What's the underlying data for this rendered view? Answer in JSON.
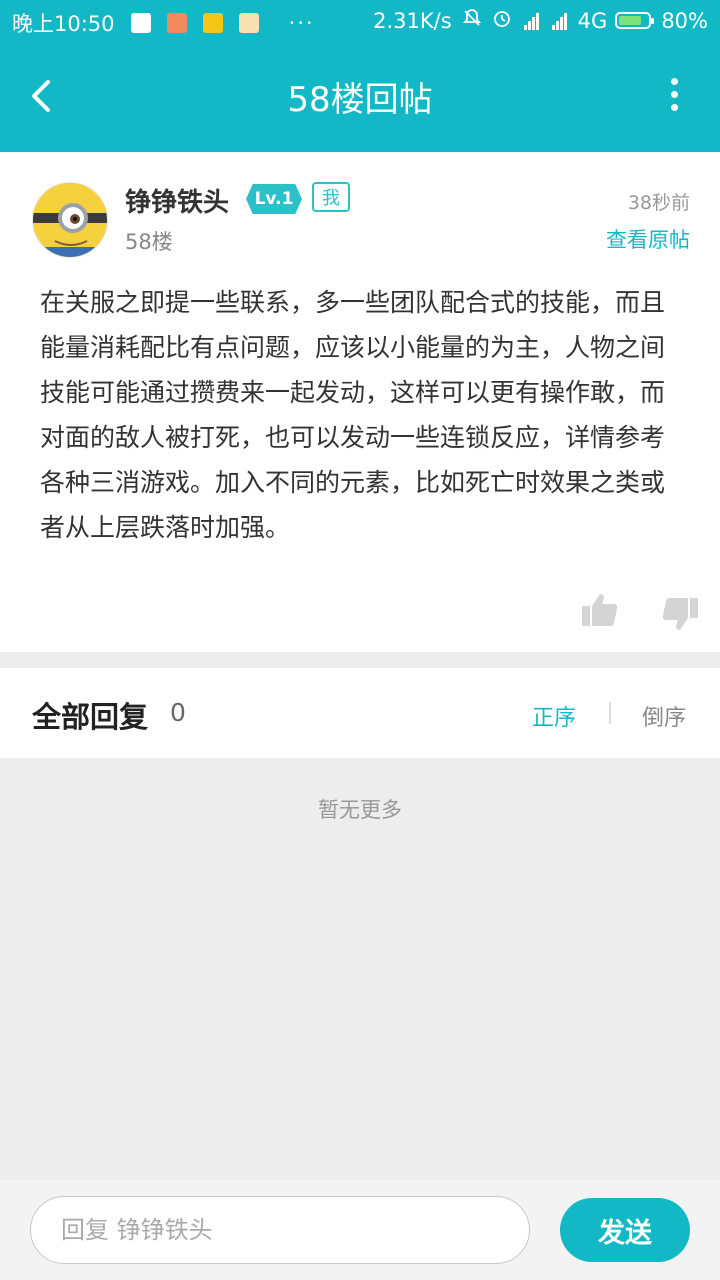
{
  "status_bar": {
    "time": "晚上10:50",
    "dots": "···",
    "net_speed": "2.31K/s",
    "network": "4G",
    "battery": "80%",
    "battery_level": 0.8
  },
  "header": {
    "title": "58楼回帖"
  },
  "post": {
    "username": "铮铮铁头",
    "level": "Lv.1",
    "me_tag": "我",
    "floor": "58楼",
    "time": "38秒前",
    "view_original": "查看原帖",
    "content": "在关服之即提一些联系，多一些团队配合式的技能，而且能量消耗配比有点问题，应该以小能量的为主，人物之间技能可能通过攒费来一起发动，这样可以更有操作敢，而对面的敌人被打死，也可以发动一些连锁反应，详情参考各种三消游戏。加入不同的元素，比如死亡时效果之类或者从上层跌落时加强。"
  },
  "replies": {
    "title": "全部回复",
    "count": "0",
    "order_asc": "正序",
    "order_desc": "倒序",
    "empty_text": "暂无更多"
  },
  "bottom": {
    "placeholder": "回复 铮铮铁头",
    "send_label": "发送"
  },
  "colors": {
    "accent": "#13b8c6",
    "badge": "#2cc1c9"
  }
}
